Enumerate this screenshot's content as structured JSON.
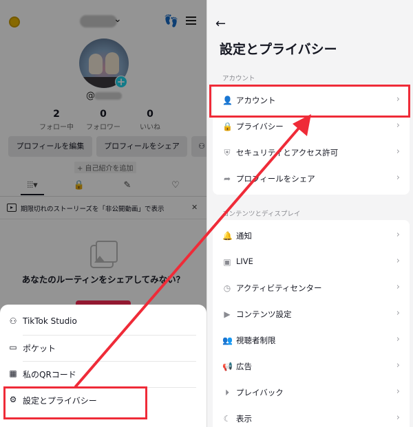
{
  "left": {
    "stats": [
      {
        "value": "2",
        "label": "フォロー中"
      },
      {
        "value": "0",
        "label": "フォロワー"
      },
      {
        "value": "0",
        "label": "いいね"
      }
    ],
    "buttons": {
      "edit_profile": "プロフィールを編集",
      "share_profile": "プロフィールをシェア"
    },
    "add_bio": "+ 自己紹介を追加",
    "handle_prefix": "@",
    "story_banner": "期限切れのストーリーズを「非公開動画」で表示",
    "empty_state": "あなたのルーティンをシェアしてみない？",
    "sheet": [
      {
        "label": "TikTok Studio",
        "icon": "studio-icon"
      },
      {
        "label": "ポケット",
        "icon": "wallet-icon"
      },
      {
        "label": "私のQRコード",
        "icon": "qr-icon"
      },
      {
        "label": "設定とプライバシー",
        "icon": "gear-icon"
      }
    ]
  },
  "right": {
    "title": "設定とプライバシー",
    "sections": [
      {
        "header": "アカウント",
        "items": [
          {
            "label": "アカウント",
            "icon": "person-icon"
          },
          {
            "label": "プライバシー",
            "icon": "lock-icon"
          },
          {
            "label": "セキュリティとアクセス許可",
            "icon": "shield-icon"
          },
          {
            "label": "プロフィールをシェア",
            "icon": "share-icon"
          }
        ]
      },
      {
        "header": "コンテンツとディスプレイ",
        "items": [
          {
            "label": "通知",
            "icon": "bell-icon"
          },
          {
            "label": "LIVE",
            "icon": "live-icon"
          },
          {
            "label": "アクティビティセンター",
            "icon": "clock-icon"
          },
          {
            "label": "コンテンツ設定",
            "icon": "video-icon"
          },
          {
            "label": "視聴者制限",
            "icon": "people-icon"
          },
          {
            "label": "広告",
            "icon": "megaphone-icon"
          },
          {
            "label": "プレイバック",
            "icon": "playback-icon"
          },
          {
            "label": "表示",
            "icon": "moon-icon"
          }
        ]
      }
    ]
  },
  "colors": {
    "highlight": "#ef2b38",
    "accent_cyan": "#20d5ec",
    "accent_red": "#fe2c55"
  }
}
